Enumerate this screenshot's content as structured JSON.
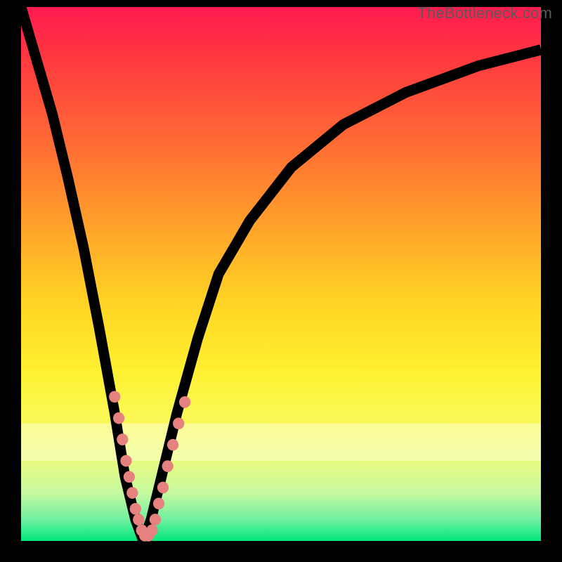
{
  "watermark": "TheBottleneck.com",
  "chart_data": {
    "type": "line",
    "title": "",
    "xlabel": "",
    "ylabel": "",
    "xlim": [
      0,
      100
    ],
    "ylim": [
      0,
      100
    ],
    "grid": false,
    "legend": false,
    "series": [
      {
        "name": "bottleneck-curve",
        "x": [
          0,
          3,
          6,
          9,
          12,
          15,
          18,
          20,
          22,
          23.5,
          25,
          27,
          30,
          34,
          38,
          44,
          52,
          62,
          74,
          88,
          100
        ],
        "y": [
          100,
          90,
          80,
          68,
          55,
          40,
          24,
          12,
          4,
          0,
          4,
          12,
          24,
          38,
          50,
          60,
          70,
          78,
          84,
          89,
          92
        ]
      }
    ],
    "markers": [
      {
        "x": 18.0,
        "y": 27
      },
      {
        "x": 18.8,
        "y": 23
      },
      {
        "x": 19.5,
        "y": 19
      },
      {
        "x": 20.2,
        "y": 15
      },
      {
        "x": 20.8,
        "y": 12
      },
      {
        "x": 21.4,
        "y": 9
      },
      {
        "x": 22.0,
        "y": 6
      },
      {
        "x": 22.6,
        "y": 4
      },
      {
        "x": 23.2,
        "y": 2
      },
      {
        "x": 23.8,
        "y": 1
      },
      {
        "x": 24.5,
        "y": 1
      },
      {
        "x": 25.2,
        "y": 2
      },
      {
        "x": 25.8,
        "y": 4
      },
      {
        "x": 26.5,
        "y": 7
      },
      {
        "x": 27.3,
        "y": 10
      },
      {
        "x": 28.2,
        "y": 14
      },
      {
        "x": 29.2,
        "y": 18
      },
      {
        "x": 30.3,
        "y": 22
      },
      {
        "x": 31.5,
        "y": 26
      }
    ],
    "marker_color": "#e5817e",
    "curve_color": "#000000",
    "gradient_stops": [
      {
        "pct": 0,
        "color": "#ff1a4f"
      },
      {
        "pct": 25,
        "color": "#ff6a35"
      },
      {
        "pct": 55,
        "color": "#ffd324"
      },
      {
        "pct": 78,
        "color": "#f9fa5a"
      },
      {
        "pct": 100,
        "color": "#00e77d"
      }
    ]
  }
}
